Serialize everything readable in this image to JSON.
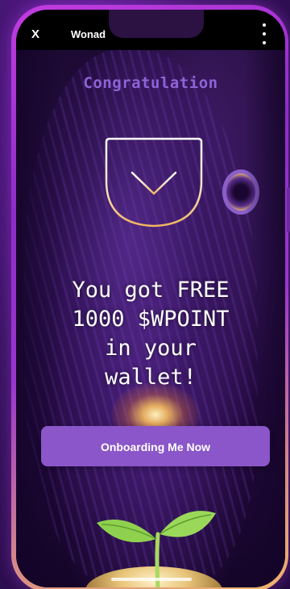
{
  "header": {
    "close_label": "X",
    "app_name": "Wonad",
    "menu_icon": "kebab-menu-icon"
  },
  "main": {
    "title": "Congratulation",
    "badge_icon": "shield-check-icon",
    "message_lines": [
      "You got FREE",
      "1000 $WPOINT",
      "in your",
      "wallet!"
    ],
    "cta_label": "Onboarding Me Now"
  },
  "colors": {
    "accent": "#8a56c9",
    "title": "#8f63d6",
    "frame_top": "#c23ce0",
    "frame_bottom": "#f2b46d"
  }
}
